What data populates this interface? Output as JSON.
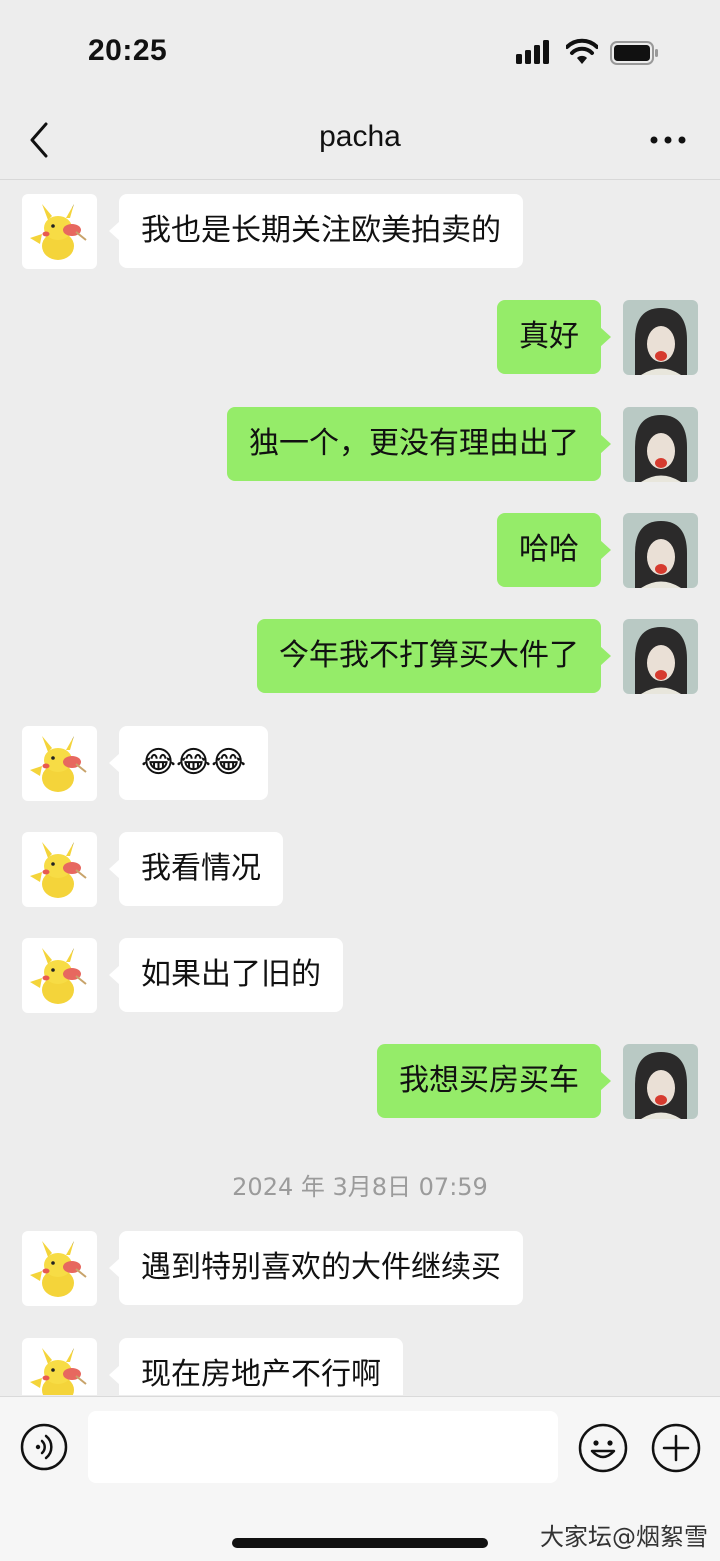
{
  "status_bar": {
    "time": "20:25"
  },
  "nav": {
    "title": "pacha"
  },
  "messages": [
    {
      "side": "left",
      "text": "我也是长期关注欧美拍卖的"
    },
    {
      "side": "right",
      "text": "真好"
    },
    {
      "side": "right",
      "text": "独一个，更没有理由出了"
    },
    {
      "side": "right",
      "text": "哈哈"
    },
    {
      "side": "right",
      "text": "今年我不打算买大件了"
    },
    {
      "side": "left",
      "text": "😂😂😂"
    },
    {
      "side": "left",
      "text": "我看情况"
    },
    {
      "side": "left",
      "text": "如果出了旧的"
    },
    {
      "side": "right",
      "text": "我想买房买车"
    },
    {
      "side": "left",
      "text": "遇到特别喜欢的大件继续买"
    },
    {
      "side": "left",
      "text": "现在房地产不行啊"
    }
  ],
  "timestamp": "2024 年 3月8日 07:59",
  "input": {
    "placeholder": ""
  },
  "watermark": "大家坛@烟絮雪",
  "colors": {
    "bubble_self": "#95ec69",
    "bubble_other": "#ffffff",
    "background": "#ededed"
  }
}
